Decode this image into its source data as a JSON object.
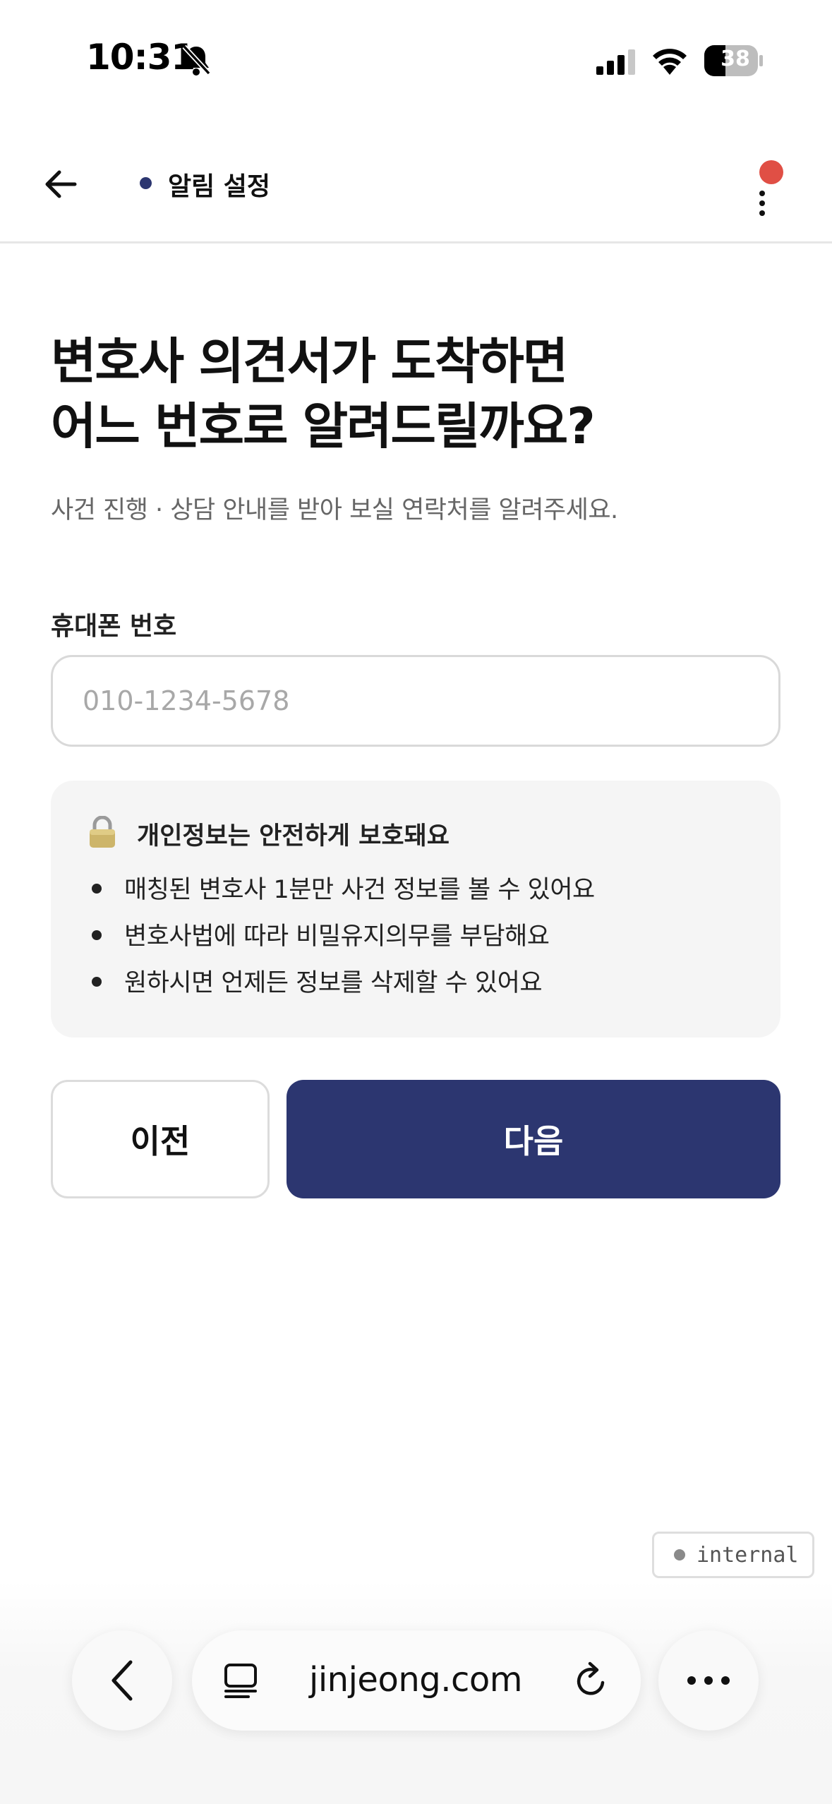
{
  "status_bar": {
    "time": "10:31",
    "battery": "38"
  },
  "header": {
    "title": "알림 설정"
  },
  "main": {
    "headline_line1": "변호사 의견서가 도착하면",
    "headline_line2": "어느 번호로 알려드릴까요?",
    "subtitle": "사건 진행 · 상담 안내를 받아 보실 연락처를 알려주세요.",
    "phone_label": "휴대폰 번호",
    "phone_placeholder": "010-1234-5678",
    "phone_value": ""
  },
  "privacy": {
    "icon": "lock-icon",
    "title": "개인정보는 안전하게 보호돼요",
    "items": [
      "매칭된 변호사 1분만 사건 정보를 볼 수 있어요",
      "변호사법에 따라 비밀유지의무를 부담해요",
      "원하시면 언제든 정보를 삭제할 수 있어요"
    ]
  },
  "buttons": {
    "prev": "이전",
    "next": "다음"
  },
  "badge": {
    "label": "internal"
  },
  "browser": {
    "url": "jinjeong.com"
  },
  "colors": {
    "primary": "#2c3670",
    "notification": "#e04f45",
    "panel": "#f5f5f5"
  }
}
